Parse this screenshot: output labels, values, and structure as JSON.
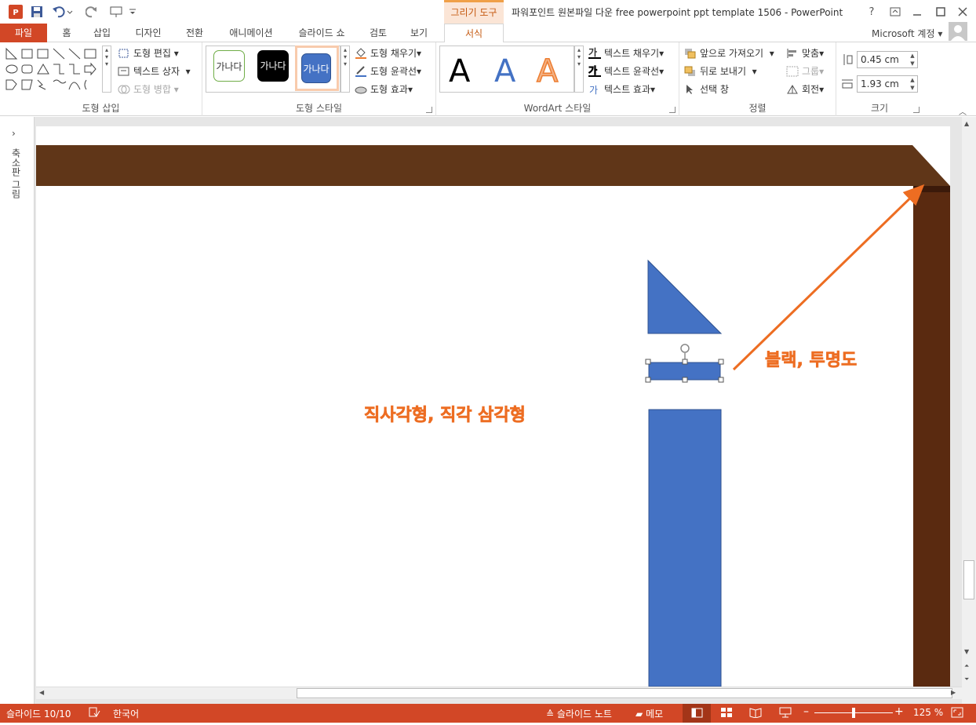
{
  "window": {
    "title": "파워포인트 원본파일 다운 free powerpoint ppt template 1506 - PowerPoint",
    "context_tool": "그리기 도구",
    "account": "Microsoft 계정"
  },
  "tabs": {
    "file": "파일",
    "home": "홈",
    "insert": "삽입",
    "design": "디자인",
    "transitions": "전환",
    "animations": "애니메이션",
    "slideshow": "슬라이드 쇼",
    "review": "검토",
    "view": "보기",
    "format": "서식"
  },
  "ribbon": {
    "insert_shapes": {
      "label": "도형 삽입",
      "edit_shape": "도형 편집",
      "text_box": "텍스트 상자",
      "merge_shapes": "도형 병합"
    },
    "shape_styles": {
      "label": "도형 스타일",
      "thumb_text": "가나다",
      "fill": "도형 채우기",
      "outline": "도형 윤곽선",
      "effects": "도형 효과"
    },
    "wordart": {
      "label": "WordArt 스타일",
      "letter": "A",
      "text_fill": "텍스트 채우기",
      "text_outline": "텍스트 윤곽선",
      "text_effects": "텍스트 효과",
      "fill_glyph": "가",
      "outline_glyph": "가"
    },
    "arrange": {
      "label": "정렬",
      "bring_forward": "앞으로 가져오기",
      "send_backward": "뒤로 보내기",
      "selection_pane": "선택 창",
      "align": "맞춤",
      "group": "그룹",
      "rotate": "회전"
    },
    "size": {
      "label": "크기",
      "height": "0.45 cm",
      "width": "1.93 cm"
    }
  },
  "thumbnail_pane": {
    "label": "축소판 그림"
  },
  "slide": {
    "annotation_main": "직사각형, 직각 삼각형",
    "annotation_side": "블랙, 투명도"
  },
  "colors": {
    "accent_red": "#d24726",
    "frame_brown": "#603618",
    "shape_blue": "#4472c4",
    "annotation_orange": "#ed6d22"
  },
  "status": {
    "slide_counter": "슬라이드 10/10",
    "language": "한국어",
    "notes": "슬라이드 노트",
    "comments": "메모",
    "zoom": "125 %"
  }
}
